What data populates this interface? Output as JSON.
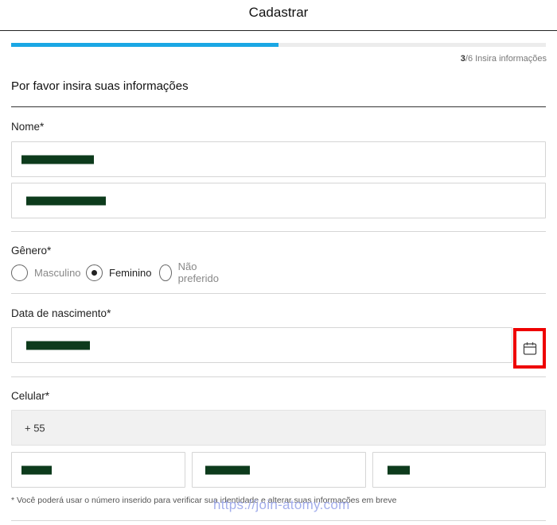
{
  "header": {
    "title": "Cadastrar"
  },
  "progress": {
    "current": 3,
    "total": 6,
    "fraction": 0.5,
    "step_sep_text": "/6 Insira informações",
    "color": "#1aa7e4"
  },
  "form": {
    "section_title": "Por favor insira suas informações",
    "name": {
      "label": "Nome*"
    },
    "gender": {
      "label": "Gênero*",
      "options": [
        "Masculino",
        "Feminino",
        "Não preferido"
      ],
      "selected": "Feminino"
    },
    "birth": {
      "label": "Data de nascimento*",
      "calendar_icon": "calendar-icon",
      "highlight_color": "#ee0000"
    },
    "phone": {
      "label": "Celular*",
      "country_code": "+ 55"
    },
    "note": "* Você poderá usar o número inserido para verificar sua identidade e alterar suas informações em breve"
  },
  "watermark": "https://join-atomy.com"
}
